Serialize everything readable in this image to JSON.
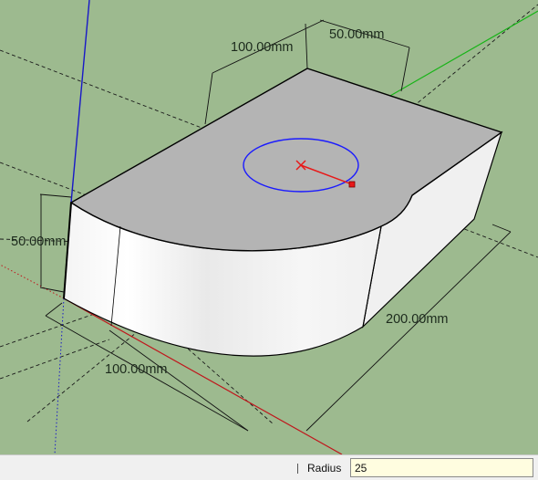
{
  "viewport": {
    "dimensions": {
      "top_width": "100.00mm",
      "top_depth": "50.00mm",
      "height": "50.00mm",
      "front_width": "100.00mm",
      "side_length": "200.00mm"
    }
  },
  "status_bar": {
    "vcb_label": "Radius",
    "vcb_value": "25"
  },
  "colors": {
    "background": "#9dba8f",
    "red_axis": "#c0161c",
    "green_axis": "#18b418",
    "blue_axis": "#1818c8",
    "circle": "#1a1aff",
    "top_face": "#b4b4b4"
  },
  "icons": {
    "circle_center": "x-marker-icon",
    "radius_endpoint": "square-endpoint-icon"
  }
}
